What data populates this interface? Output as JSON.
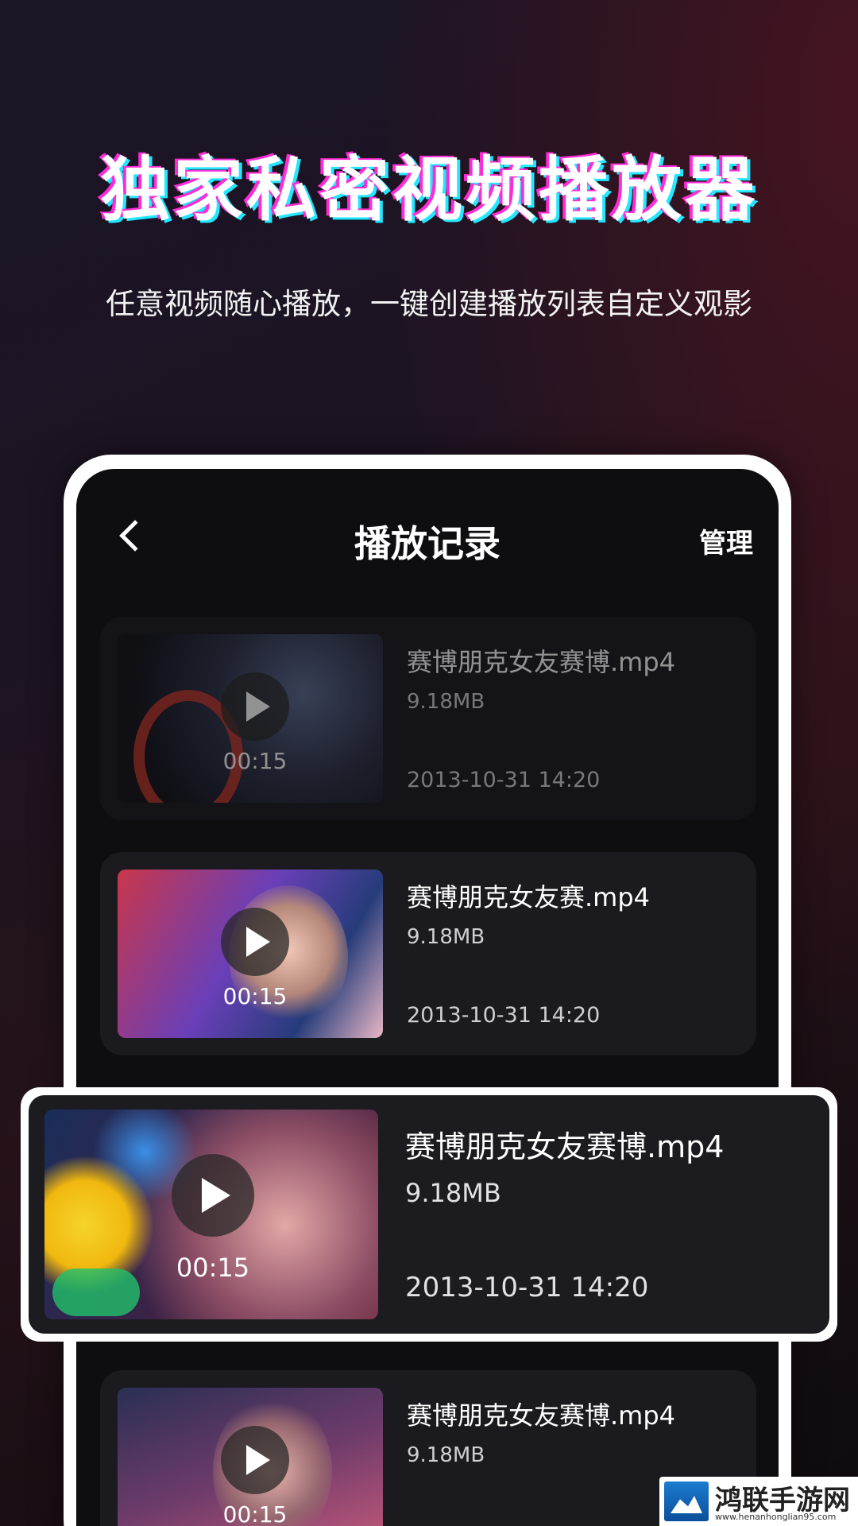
{
  "promo": {
    "headline": "独家私密视频播放器",
    "subtitle": "任意视频随心播放，一键创建播放列表自定义观影"
  },
  "nav": {
    "back_icon": "chevron-left-icon",
    "title": "播放记录",
    "manage": "管理"
  },
  "videos": [
    {
      "filename": "赛博朋克女友赛博.mp4",
      "size": "9.18MB",
      "date": "2013-10-31  14:20",
      "duration": "00:15",
      "play_icon": "play-icon"
    },
    {
      "filename": "赛博朋克女友赛.mp4",
      "size": "9.18MB",
      "date": "2013-10-31  14:20",
      "duration": "00:15",
      "play_icon": "play-icon"
    },
    {
      "filename": "赛博朋克女友赛博.mp4",
      "size": "9.18MB",
      "date": "2013-10-31  14:20",
      "duration": "00:15",
      "play_icon": "play-icon"
    },
    {
      "filename": "赛博朋克女友赛博.mp4",
      "size": "9.18MB",
      "date": "",
      "duration": "00:15",
      "play_icon": "play-icon"
    }
  ],
  "watermark": {
    "title": "鸿联手游网",
    "url": "www.henanhonglian95.com"
  },
  "colors": {
    "headline_glow_pink": "#ff2bd6",
    "headline_glow_cyan": "#23e6ff",
    "card_bg": "#1a1a1f",
    "screen_bg": "#0e0e10"
  }
}
